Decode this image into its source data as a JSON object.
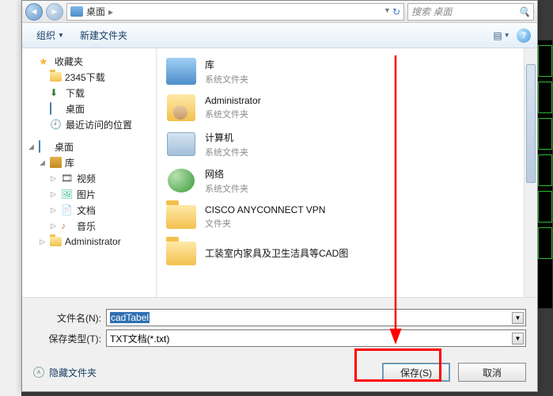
{
  "addr": {
    "location": "桌面",
    "search_placeholder": "搜索 桌面"
  },
  "toolbar": {
    "organize": "组织",
    "new_folder": "新建文件夹"
  },
  "tree": {
    "favorites": "收藏夹",
    "item_2345": "2345下载",
    "downloads": "下载",
    "desktop": "桌面",
    "recent": "最近访问的位置",
    "desktop2": "桌面",
    "library": "库",
    "video": "视频",
    "pictures": "图片",
    "docs": "文档",
    "music": "音乐",
    "admin": "Administrator"
  },
  "items": [
    {
      "name": "库",
      "sub": "系统文件夹",
      "icon": "library"
    },
    {
      "name": "Administrator",
      "sub": "系统文件夹",
      "icon": "admin"
    },
    {
      "name": "计算机",
      "sub": "系统文件夹",
      "icon": "computer"
    },
    {
      "name": "网络",
      "sub": "系统文件夹",
      "icon": "network"
    },
    {
      "name": "CISCO ANYCONNECT VPN",
      "sub": "文件夹",
      "icon": "folder"
    },
    {
      "name": "工装室内家具及卫生洁具等CAD图",
      "sub": "",
      "icon": "folder"
    }
  ],
  "fields": {
    "name_label": "文件名(N):",
    "name_value": "cadTabel",
    "type_label": "保存类型(T):",
    "type_value": "TXT文档(*.txt)"
  },
  "footer": {
    "hide_files": "隐藏文件夹",
    "save": "保存(S)",
    "cancel": "取消"
  }
}
